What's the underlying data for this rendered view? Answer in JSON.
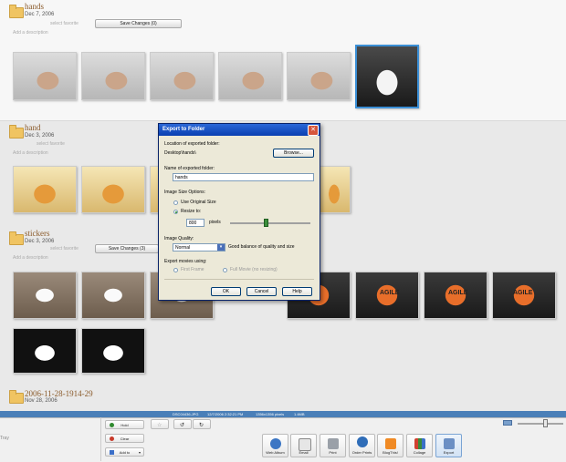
{
  "albums": [
    {
      "title": "hands",
      "date": "Dec 7, 2006",
      "select_hint": "select favorite",
      "save_label": "Save Changes (0)",
      "description": "Add a description"
    },
    {
      "title": "hand",
      "date": "Dec 3, 2006",
      "select_hint": "select favorite",
      "description": "Add a description"
    },
    {
      "title": "stickers",
      "date": "Dec 3, 2006",
      "select_hint": "select favorite",
      "save_label": "Save Changes (3)",
      "description": "Add a description"
    },
    {
      "title": "2006-11-28-1914-29",
      "date": "Nov 28, 2006"
    }
  ],
  "agile_text": "AGILE",
  "dialog": {
    "title": "Export to Folder",
    "close_icon": "close-icon",
    "location_label": "Location of exported folder:",
    "location_value": "Desktop\\hands\\",
    "browse_label": "Browse...",
    "name_label": "Name of exported folder:",
    "name_value": "hands",
    "size_options_label": "Image Size Options:",
    "original_size_label": "Use Original Size",
    "resize_label": "Resize to:",
    "resize_value": "800",
    "pixels_label": "pixels",
    "resize_slider_fraction": 0.45,
    "quality_label": "Image Quality:",
    "quality_value": "Normal",
    "quality_hint": "Good balance of quality and size",
    "movies_label": "Export movies using:",
    "first_frame_label": "First Frame",
    "full_movie_label": "Full Movie (no resizing)",
    "ok_label": "OK",
    "cancel_label": "Cancel",
    "help_label": "Help"
  },
  "status": {
    "filename": "DSC04436.JPG",
    "datetime": "12/7/2006 2:32:21 PM",
    "dimensions": "1356x1356 pixels",
    "filesize": "1.4MB"
  },
  "left_panel": {
    "partial_label": "Tray",
    "hold_label": "Hold",
    "clear_label": "Clear",
    "add_to_label": "Add to"
  },
  "toolbar": {
    "items": [
      "Web Album",
      "Email",
      "Print",
      "Order Prints",
      "BlogThis!",
      "Collage",
      "Export"
    ]
  },
  "zoom": {
    "level_fraction": 0.62
  },
  "colors": {
    "accent": "#3b8fd6",
    "title_bar": "#0a3fb0",
    "status_bar": "#4a7fb8"
  }
}
